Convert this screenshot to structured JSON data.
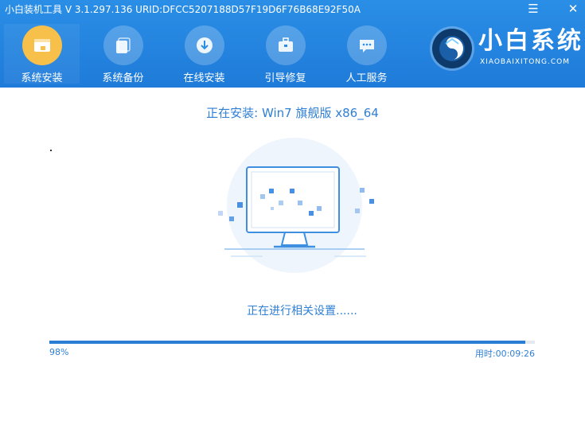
{
  "window": {
    "title": "小白装机工具 V 3.1.297.136 URID:DFCC5207188D57F19D6F76B68E92F50A",
    "menu_glyph": "☰",
    "close_glyph": "✕"
  },
  "nav": [
    {
      "label": "系统安装",
      "icon": "window-icon",
      "active": true
    },
    {
      "label": "系统备份",
      "icon": "backup-icon",
      "active": false
    },
    {
      "label": "在线安装",
      "icon": "download-icon",
      "active": false
    },
    {
      "label": "引导修复",
      "icon": "toolbox-icon",
      "active": false
    },
    {
      "label": "人工服务",
      "icon": "chat-icon",
      "active": false
    }
  ],
  "brand": {
    "name": "小白系统",
    "domain": "XIAOBAIXITONG.COM"
  },
  "install": {
    "title": "正在安装: Win7 旗舰版 x86_64",
    "status": "正在进行相关设置......"
  },
  "progress": {
    "percent": 98,
    "percent_text": "98%",
    "elapsed_text": "用时:00:09:26"
  },
  "colors": {
    "header": "#1f7bd9",
    "accent": "#2f7fd4",
    "active_icon": "#f7c04a"
  }
}
